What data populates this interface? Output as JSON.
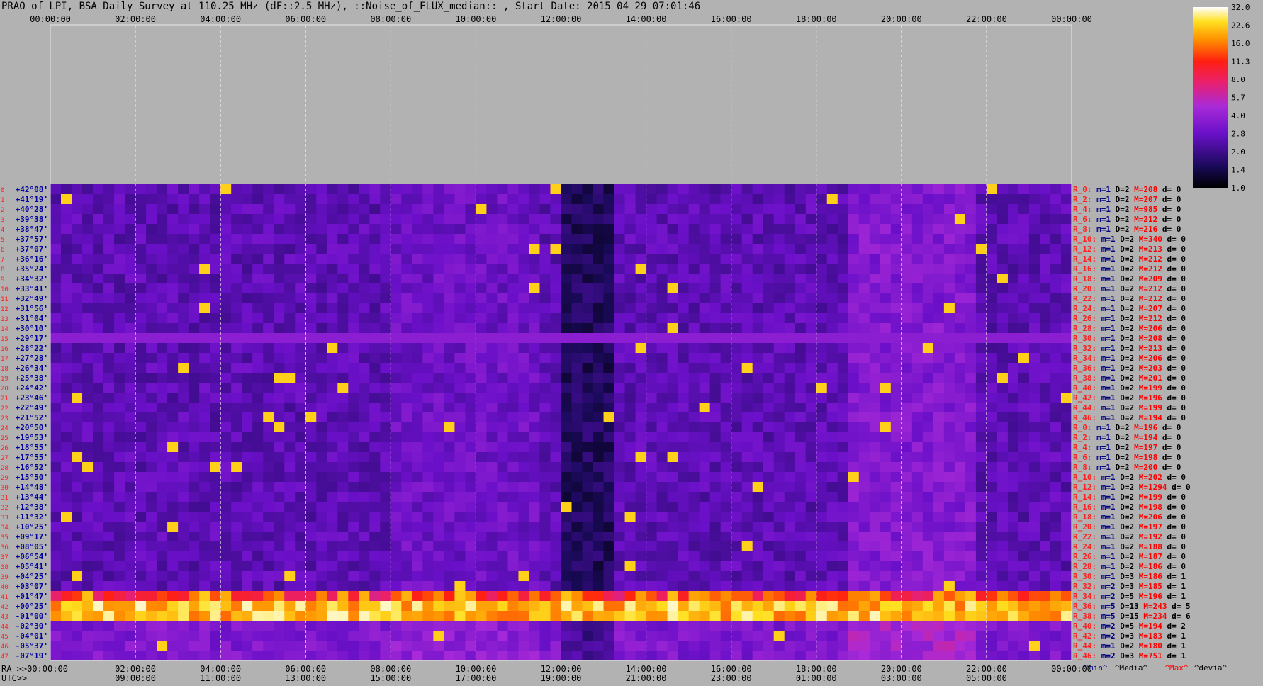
{
  "title": "PRAO of LPI, BSA Daily Survey at 110.25 MHz (dF::2.5 MHz), ::Noise_of_FLUX_median:: , Start Date: 2015 04 29 07:01:46",
  "chart_data": {
    "type": "heatmap",
    "title": "PRAO of LPI, BSA Daily Survey at 110.25 MHz (dF::2.5 MHz), ::Noise_of_FLUX_median:: , Start Date: 2015 04 29 07:01:46",
    "x_ra_top": [
      "00:00:00",
      "02:00:00",
      "04:00:00",
      "06:00:00",
      "08:00:00",
      "10:00:00",
      "12:00:00",
      "14:00:00",
      "16:00:00",
      "18:00:00",
      "20:00:00",
      "22:00:00",
      "00:00:00"
    ],
    "x_ra_bottom": [
      "RA >>00:00:00",
      "02:00:00",
      "04:00:00",
      "06:00:00",
      "08:00:00",
      "10:00:00",
      "12:00:00",
      "14:00:00",
      "16:00:00",
      "18:00:00",
      "20:00:00",
      "22:00:00",
      "00:00:00"
    ],
    "x_utc": [
      "UTC>>",
      "09:00:00",
      "11:00:00",
      "13:00:00",
      "15:00:00",
      "17:00:00",
      "19:00:00",
      "21:00:00",
      "23:00:00",
      "01:00:00",
      "03:00:00",
      "05:00:00"
    ],
    "declinations": [
      "+42°08'",
      "+41°19'",
      "+40°28'",
      "+39°38'",
      "+38°47'",
      "+37°57'",
      "+37°07'",
      "+36°16'",
      "+35°24'",
      "+34°32'",
      "+33°41'",
      "+32°49'",
      "+31°56'",
      "+31°04'",
      "+30°10'",
      "+29°17'",
      "+28°22'",
      "+27°28'",
      "+26°34'",
      "+25°38'",
      "+24°42'",
      "+23°46'",
      "+22°49'",
      "+21°52'",
      "+20°50'",
      "+19°53'",
      "+18°55'",
      "+17°55'",
      "+16°52'",
      "+15°50'",
      "+14°48'",
      "+13°44'",
      "+12°38'",
      "+11°32'",
      "+10°25'",
      "+09°17'",
      "+08°05'",
      "+06°54'",
      "+05°41'",
      "+04°25'",
      "+03°07'",
      "+01°47'",
      "+00°25'",
      "-01°00'",
      "-02°30'",
      "-04°01'",
      "-05°37'",
      "-07°19'"
    ],
    "row_stats": [
      {
        "r": "R_0:",
        "min": "m=1",
        "med": "D=2",
        "max": "M=208",
        "dev": "d= 0"
      },
      {
        "r": "R_2:",
        "min": "m=1",
        "med": "D=2",
        "max": "M=207",
        "dev": "d= 0"
      },
      {
        "r": "R_4:",
        "min": "m=1",
        "med": "D=2",
        "max": "M=985",
        "dev": "d= 0"
      },
      {
        "r": "R_6:",
        "min": "m=1",
        "med": "D=2",
        "max": "M=212",
        "dev": "d= 0"
      },
      {
        "r": "R_8:",
        "min": "m=1",
        "med": "D=2",
        "max": "M=216",
        "dev": "d= 0"
      },
      {
        "r": "R_10:",
        "min": "m=1",
        "med": "D=2",
        "max": "M=340",
        "dev": "d= 0"
      },
      {
        "r": "R_12:",
        "min": "m=1",
        "med": "D=2",
        "max": "M=213",
        "dev": "d= 0"
      },
      {
        "r": "R_14:",
        "min": "m=1",
        "med": "D=2",
        "max": "M=212",
        "dev": "d= 0"
      },
      {
        "r": "R_16:",
        "min": "m=1",
        "med": "D=2",
        "max": "M=212",
        "dev": "d= 0"
      },
      {
        "r": "R_18:",
        "min": "m=1",
        "med": "D=2",
        "max": "M=209",
        "dev": "d= 0"
      },
      {
        "r": "R_20:",
        "min": "m=1",
        "med": "D=2",
        "max": "M=212",
        "dev": "d= 0"
      },
      {
        "r": "R_22:",
        "min": "m=1",
        "med": "D=2",
        "max": "M=212",
        "dev": "d= 0"
      },
      {
        "r": "R_24:",
        "min": "m=1",
        "med": "D=2",
        "max": "M=207",
        "dev": "d= 0"
      },
      {
        "r": "R_26:",
        "min": "m=1",
        "med": "D=2",
        "max": "M=212",
        "dev": "d= 0"
      },
      {
        "r": "R_28:",
        "min": "m=1",
        "med": "D=2",
        "max": "M=206",
        "dev": "d= 0"
      },
      {
        "r": "R_30:",
        "min": "m=1",
        "med": "D=2",
        "max": "M=208",
        "dev": "d= 0"
      },
      {
        "r": "R_32:",
        "min": "m=1",
        "med": "D=2",
        "max": "M=213",
        "dev": "d= 0"
      },
      {
        "r": "R_34:",
        "min": "m=1",
        "med": "D=2",
        "max": "M=206",
        "dev": "d= 0"
      },
      {
        "r": "R_36:",
        "min": "m=1",
        "med": "D=2",
        "max": "M=203",
        "dev": "d= 0"
      },
      {
        "r": "R_38:",
        "min": "m=1",
        "med": "D=2",
        "max": "M=201",
        "dev": "d= 0"
      },
      {
        "r": "R_40:",
        "min": "m=1",
        "med": "D=2",
        "max": "M=199",
        "dev": "d= 0"
      },
      {
        "r": "R_42:",
        "min": "m=1",
        "med": "D=2",
        "max": "M=196",
        "dev": "d= 0"
      },
      {
        "r": "R_44:",
        "min": "m=1",
        "med": "D=2",
        "max": "M=199",
        "dev": "d= 0"
      },
      {
        "r": "R_46:",
        "min": "m=1",
        "med": "D=2",
        "max": "M=194",
        "dev": "d= 0"
      },
      {
        "r": "R_0:",
        "min": "m=1",
        "med": "D=2",
        "max": "M=196",
        "dev": "d= 0"
      },
      {
        "r": "R_2:",
        "min": "m=1",
        "med": "D=2",
        "max": "M=194",
        "dev": "d= 0"
      },
      {
        "r": "R_4:",
        "min": "m=1",
        "med": "D=2",
        "max": "M=197",
        "dev": "d= 0"
      },
      {
        "r": "R_6:",
        "min": "m=1",
        "med": "D=2",
        "max": "M=198",
        "dev": "d= 0"
      },
      {
        "r": "R_8:",
        "min": "m=1",
        "med": "D=2",
        "max": "M=200",
        "dev": "d= 0"
      },
      {
        "r": "R_10:",
        "min": "m=1",
        "med": "D=2",
        "max": "M=202",
        "dev": "d= 0"
      },
      {
        "r": "R_12:",
        "min": "m=1",
        "med": "D=2",
        "max": "M=1294",
        "dev": "d= 0"
      },
      {
        "r": "R_14:",
        "min": "m=1",
        "med": "D=2",
        "max": "M=199",
        "dev": "d= 0"
      },
      {
        "r": "R_16:",
        "min": "m=1",
        "med": "D=2",
        "max": "M=198",
        "dev": "d= 0"
      },
      {
        "r": "R_18:",
        "min": "m=1",
        "med": "D=2",
        "max": "M=206",
        "dev": "d= 0"
      },
      {
        "r": "R_20:",
        "min": "m=1",
        "med": "D=2",
        "max": "M=197",
        "dev": "d= 0"
      },
      {
        "r": "R_22:",
        "min": "m=1",
        "med": "D=2",
        "max": "M=192",
        "dev": "d= 0"
      },
      {
        "r": "R_24:",
        "min": "m=1",
        "med": "D=2",
        "max": "M=188",
        "dev": "d= 0"
      },
      {
        "r": "R_26:",
        "min": "m=1",
        "med": "D=2",
        "max": "M=187",
        "dev": "d= 0"
      },
      {
        "r": "R_28:",
        "min": "m=1",
        "med": "D=2",
        "max": "M=186",
        "dev": "d= 0"
      },
      {
        "r": "R_30:",
        "min": "m=1",
        "med": "D=3",
        "max": "M=186",
        "dev": "d= 1"
      },
      {
        "r": "R_32:",
        "min": "m=2",
        "med": "D=3",
        "max": "M=185",
        "dev": "d= 1"
      },
      {
        "r": "R_34:",
        "min": "m=2",
        "med": "D=5",
        "max": "M=196",
        "dev": "d= 1"
      },
      {
        "r": "R_36:",
        "min": "m=5",
        "med": "D=13",
        "max": "M=243",
        "dev": "d= 5"
      },
      {
        "r": "R_38:",
        "min": "m=5",
        "med": "D=15",
        "max": "M=234",
        "dev": "d= 6"
      },
      {
        "r": "R_40:",
        "min": "m=2",
        "med": "D=5",
        "max": "M=194",
        "dev": "d= 2"
      },
      {
        "r": "R_42:",
        "min": "m=2",
        "med": "D=3",
        "max": "M=183",
        "dev": "d= 1"
      },
      {
        "r": "R_44:",
        "min": "m=1",
        "med": "D=2",
        "max": "M=180",
        "dev": "d= 1"
      },
      {
        "r": "R_46:",
        "min": "m=2",
        "med": "D=3",
        "max": "M=751",
        "dev": "d= 1"
      }
    ],
    "stats_legend": [
      "^min^",
      "^Media^",
      "^Max^",
      "^devia^"
    ],
    "colorbar": {
      "ticks": [
        "32.0",
        "22.6",
        "16.0",
        "11.3",
        "8.0",
        "5.7",
        "4.0",
        "2.8",
        "2.0",
        "1.4",
        "1.0"
      ],
      "scale": "log",
      "range": [
        1.0,
        32.0
      ]
    },
    "colors": {
      "background": "#b2b2b2",
      "dec_label": "#0000a0",
      "row_index": "#ff2020",
      "stat_min": "#000080",
      "stat_max": "#ff0000"
    }
  }
}
